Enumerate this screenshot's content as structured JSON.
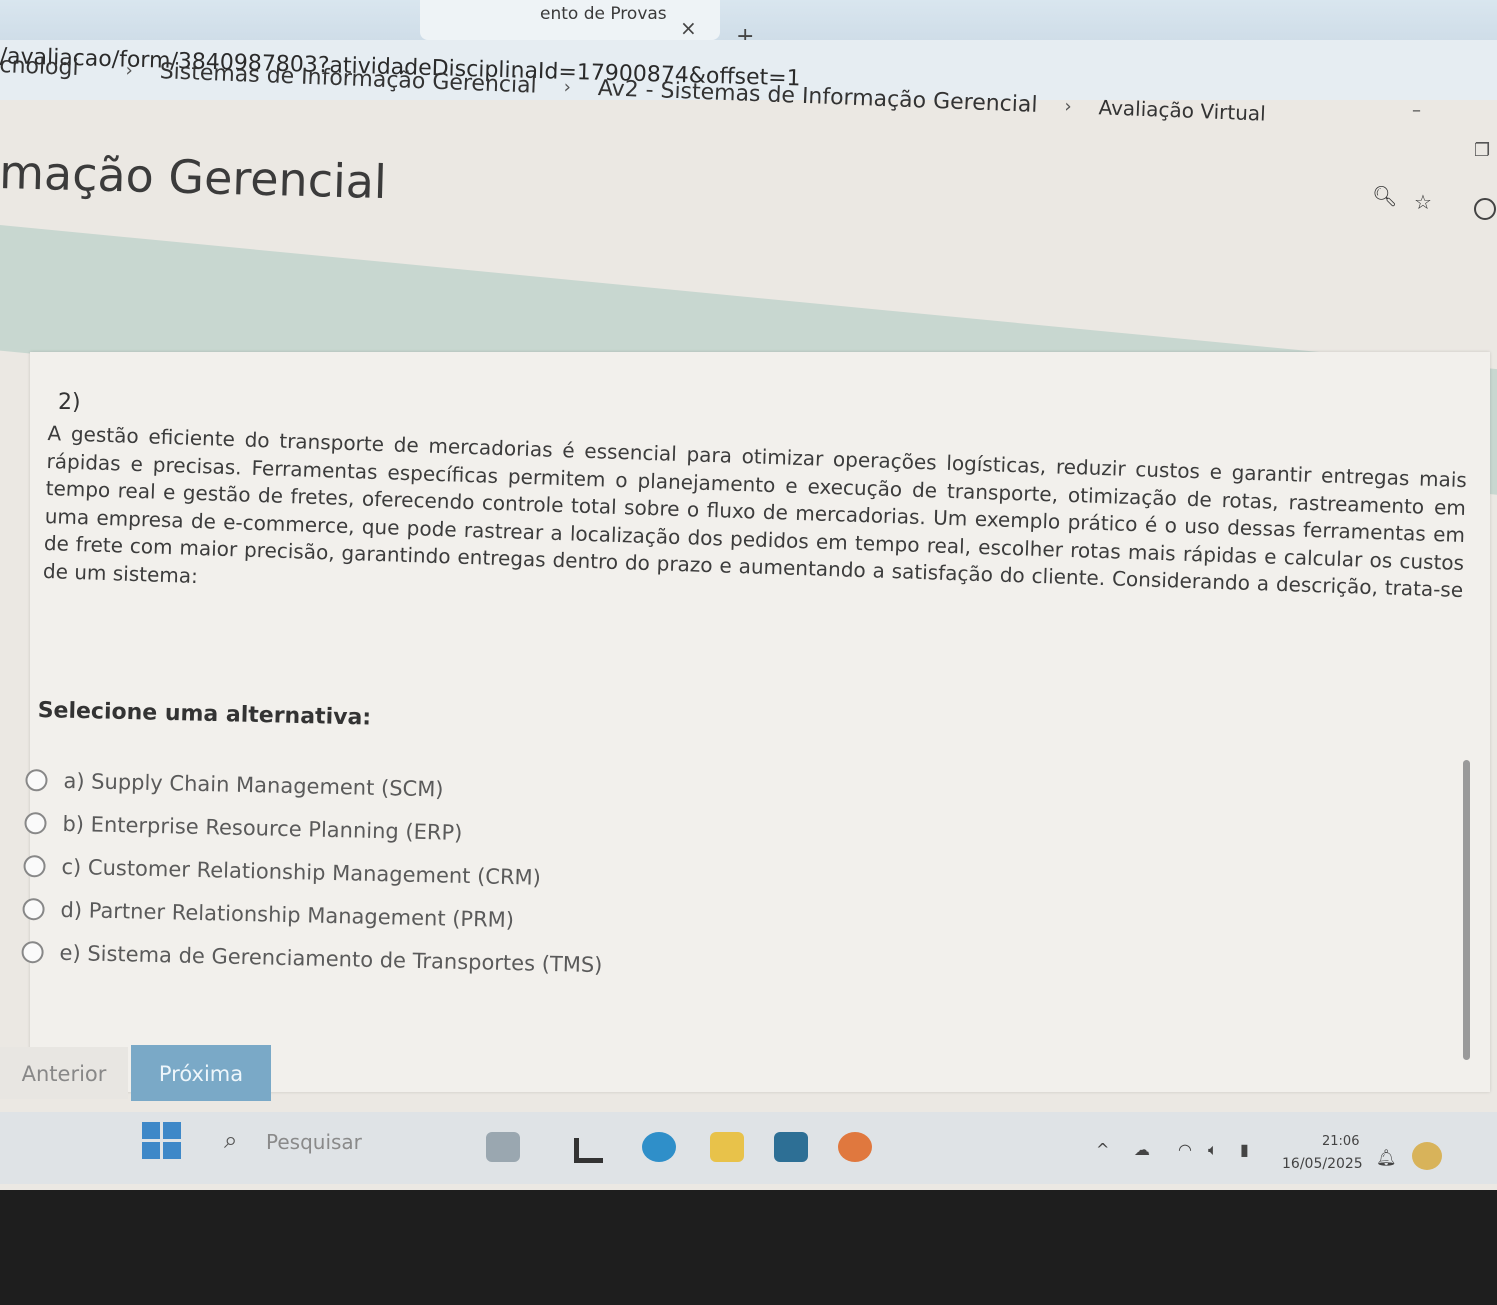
{
  "browser": {
    "tab_title": "ento de Provas",
    "tab_close": "×",
    "new_tab": "+",
    "url": "/avaliacao/form/3840987803?atividadeDisciplinaId=17900874&offset=1"
  },
  "breadcrumb": {
    "items": [
      "cnologi",
      "Sistemas de Informação Gerencial",
      "Av2 - Sistemas de Informação Gerencial",
      "Avaliação Virtual"
    ],
    "separator": "›"
  },
  "page": {
    "title": "mação Gerencial"
  },
  "question": {
    "number": "2)",
    "text": "A gestão eficiente do transporte de mercadorias é essencial para otimizar operações logísticas, reduzir custos e garantir entregas mais rápidas e precisas. Ferramentas específicas permitem o planejamento e execução de transporte, otimização de rotas, rastreamento em tempo real e gestão de fretes, oferecendo controle total sobre o fluxo de mercadorias. Um exemplo prático é o uso dessas ferramentas em uma empresa de e-commerce, que pode rastrear a localização dos pedidos em tempo real, escolher rotas mais rápidas e calcular os custos de frete com maior precisão, garantindo entregas dentro do prazo e aumentando a satisfação do cliente. Considerando a descrição, trata-se de um sistema:",
    "select_label": "Selecione uma alternativa:",
    "options": [
      "a) Supply Chain Management (SCM)",
      "b) Enterprise Resource Planning (ERP)",
      "c) Customer Relationship Management (CRM)",
      "d) Partner Relationship Management (PRM)",
      "e) Sistema de Gerenciamento de Transportes (TMS)"
    ]
  },
  "navigation": {
    "prev_label": "Anterior",
    "next_label": "Próxima"
  },
  "taskbar": {
    "search_placeholder": "Pesquisar",
    "time": "21:06",
    "date": "16/05/2025"
  },
  "colors": {
    "next_button": "#7aa9c7",
    "band": "#c8d7d0",
    "windows_logo": "#3e88c8"
  }
}
